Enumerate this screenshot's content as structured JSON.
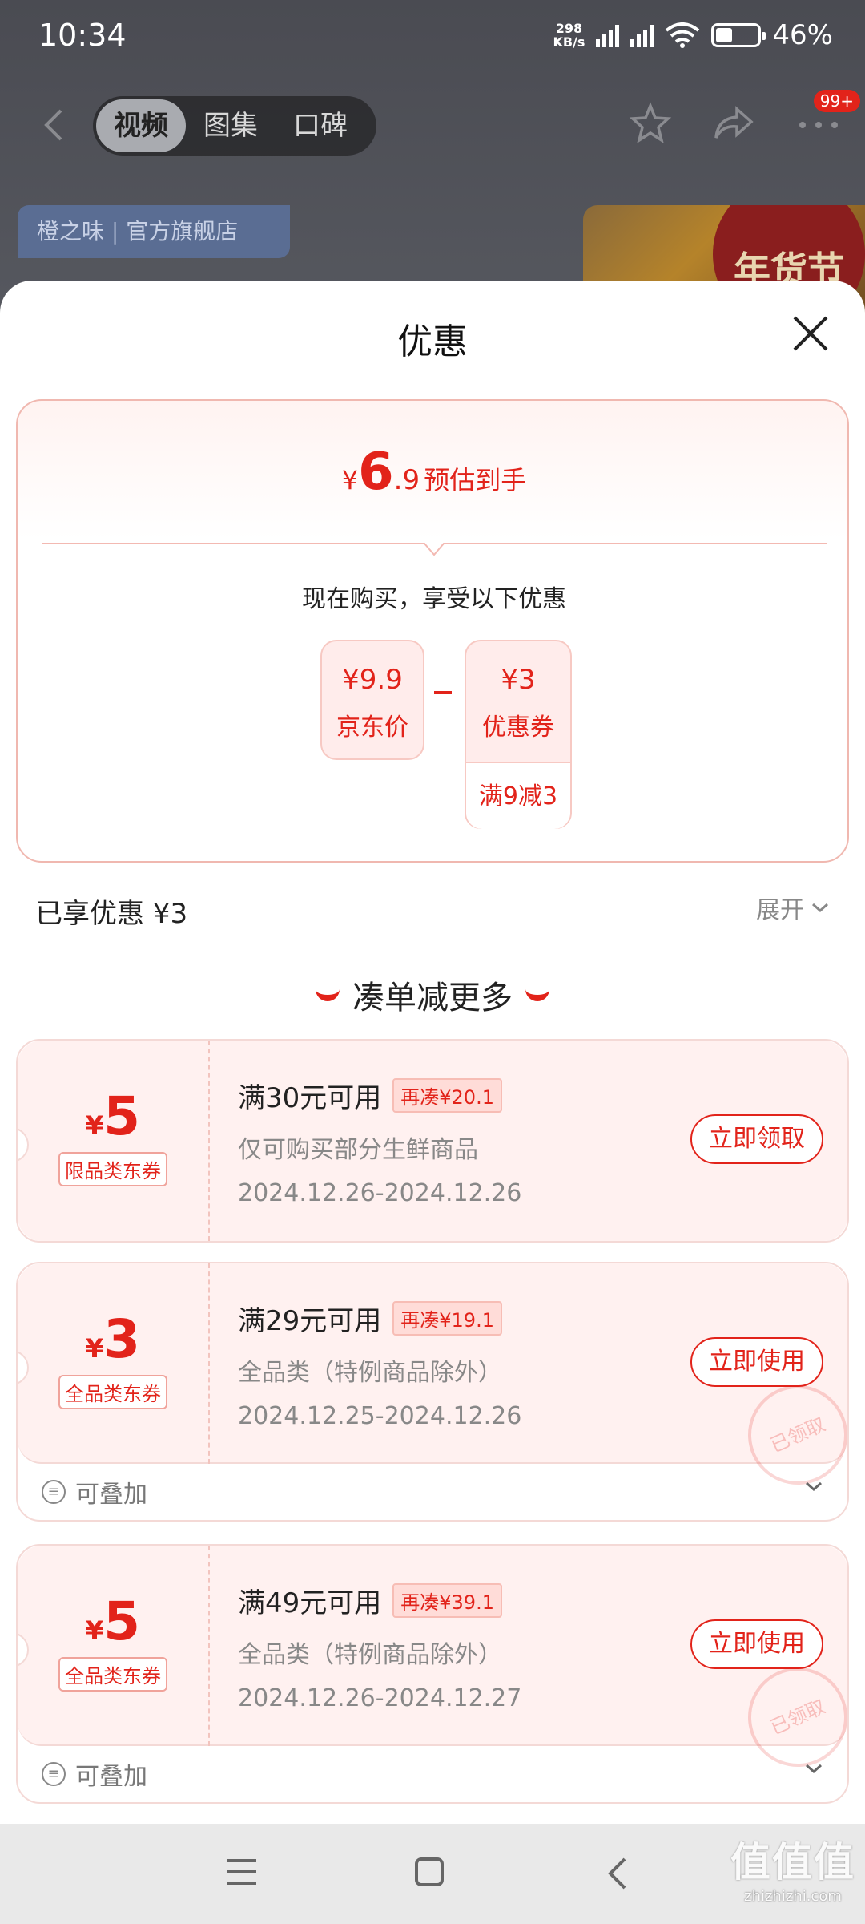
{
  "status": {
    "time": "10:34",
    "net_speed_value": "298",
    "net_speed_unit": "KB/s",
    "battery": "46%",
    "battery_level": 0.46
  },
  "nav": {
    "tabs": [
      {
        "label": "视频",
        "active": true
      },
      {
        "label": "图集",
        "active": false
      },
      {
        "label": "口碑",
        "active": false
      }
    ],
    "badge": "99+"
  },
  "background": {
    "shop_name": "橙之味",
    "shop_type": "官方旗舰店",
    "festival_label": "年货节"
  },
  "sheet": {
    "title": "优惠",
    "estimate": {
      "currency": "¥",
      "integer": "6",
      "decimal": ".9",
      "label": "预估到手"
    },
    "buy_note": "现在购买，享受以下优惠",
    "calc": {
      "base_amount": "¥9.9",
      "base_label": "京东价",
      "operator": "-",
      "coupon_amount": "¥3",
      "coupon_label": "优惠券",
      "coupon_condition": "满9减3"
    },
    "enjoyed": "已享优惠 ¥3",
    "expand": "展开",
    "more_title": "凑单减更多"
  },
  "coupons": [
    {
      "currency": "¥",
      "amount": "5",
      "type": "限品类东券",
      "condition": "满30元可用",
      "tag": "再凑¥20.1",
      "desc": "仅可购买部分生鲜商品",
      "date": "2024.12.26-2024.12.26",
      "button": "立即领取",
      "claimed": false,
      "stackable": ""
    },
    {
      "currency": "¥",
      "amount": "3",
      "type": "全品类东券",
      "condition": "满29元可用",
      "tag": "再凑¥19.1",
      "desc": "全品类（特例商品除外）",
      "date": "2024.12.25-2024.12.26",
      "button": "立即使用",
      "claimed": true,
      "stamp": "已领取",
      "stackable": "可叠加"
    },
    {
      "currency": "¥",
      "amount": "5",
      "type": "全品类东券",
      "condition": "满49元可用",
      "tag": "再凑¥39.1",
      "desc": "全品类（特例商品除外）",
      "date": "2024.12.26-2024.12.27",
      "button": "立即使用",
      "claimed": true,
      "stamp": "已领取",
      "stackable": "可叠加"
    }
  ],
  "watermark": {
    "logo": "值值值",
    "url": "zhizhizhi.com"
  },
  "colors": {
    "accent": "#e2231a",
    "coupon_bg": "#fff1f0",
    "overlay": "#56585f"
  }
}
